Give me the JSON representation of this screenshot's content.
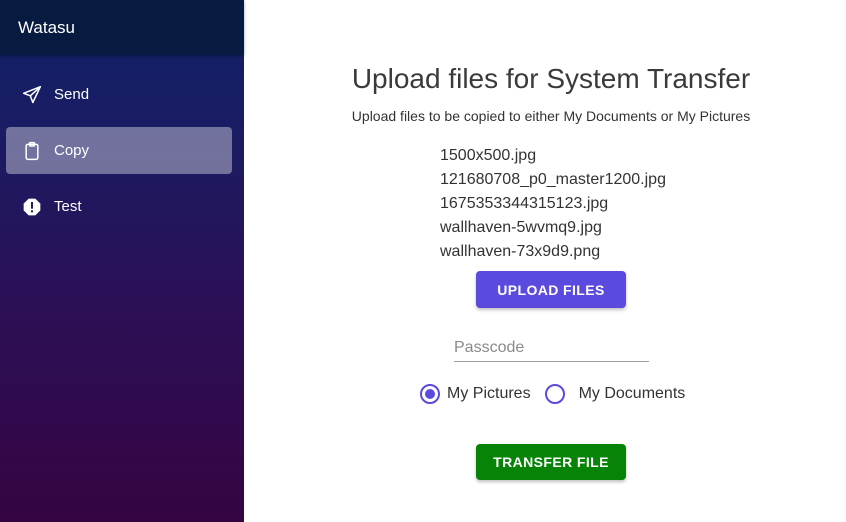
{
  "app": {
    "title": "Watasu"
  },
  "sidebar": {
    "items": [
      {
        "label": "Send",
        "icon": "send-icon",
        "active": false
      },
      {
        "label": "Copy",
        "icon": "clipboard-icon",
        "active": true
      },
      {
        "label": "Test",
        "icon": "alert-octagon-icon",
        "active": false
      }
    ]
  },
  "main": {
    "title": "Upload files for System Transfer",
    "subtitle": "Upload files to be copied to either My Documents or My Pictures",
    "files": [
      "1500x500.jpg",
      "121680708_p0_master1200.jpg",
      "1675353344315123.jpg",
      "wallhaven-5wvmq9.jpg",
      "wallhaven-73x9d9.png"
    ],
    "upload_button": "UPLOAD FILES",
    "passcode": {
      "placeholder": "Passcode",
      "value": ""
    },
    "destination": {
      "options": [
        "My Pictures",
        "My Documents"
      ],
      "selected": "My Pictures"
    },
    "transfer_button": "TRANSFER FILE"
  },
  "colors": {
    "accent": "#5a4bde",
    "transfer": "#078307",
    "sidebar_header": "#071a3f"
  }
}
